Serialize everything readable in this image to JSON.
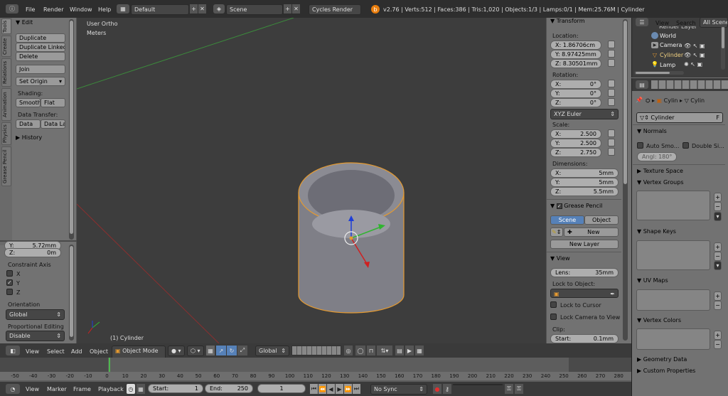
{
  "top_menu": {
    "file": "File",
    "render": "Render",
    "window": "Window",
    "help": "Help",
    "layout": "Default",
    "scene": "Scene",
    "engine": "Cycles Render",
    "stats": "v2.76 | Verts:512 | Faces:386 | Tris:1,020 | Objects:1/3 | Lamps:0/1 | Mem:25.76M | Cylinder"
  },
  "left_tabs": [
    "Tools",
    "Create",
    "Relations",
    "Animation",
    "Physics",
    "Grease Pencil"
  ],
  "tools": {
    "edit_header": "Edit",
    "duplicate": "Duplicate",
    "duplicate_linked": "Duplicate Linked",
    "delete": "Delete",
    "join": "Join",
    "set_origin": "Set Origin",
    "shading_label": "Shading:",
    "smooth": "Smooth",
    "flat": "Flat",
    "data_transfer_label": "Data Transfer:",
    "data": "Data",
    "data_layout": "Data La",
    "history": "History"
  },
  "operator": {
    "y_label": "Y:",
    "y_value": "5.72mm",
    "z_label": "Z:",
    "z_value": "0m",
    "constraint_axis": "Constraint Axis",
    "x": "X",
    "y": "Y",
    "z": "Z",
    "orientation_label": "Orientation",
    "orientation": "Global",
    "proportional_label": "Proportional Editing",
    "proportional": "Disable"
  },
  "viewport": {
    "view_name": "User Ortho",
    "units": "Meters",
    "object_label": "(1) Cylinder"
  },
  "view3d_header": {
    "view": "View",
    "select": "Select",
    "add": "Add",
    "object": "Object",
    "mode": "Object Mode",
    "orientation": "Global"
  },
  "properties_n": {
    "transform_header": "Transform",
    "location_label": "Location:",
    "loc_x_label": "X:",
    "loc_x": "1.86706cm",
    "loc_y_label": "Y:",
    "loc_y": "8.97425mm",
    "loc_z_label": "Z:",
    "loc_z": "8.30501mm",
    "rotation_label": "Rotation:",
    "rot_x_label": "X:",
    "rot_x": "0°",
    "rot_y_label": "Y:",
    "rot_y": "0°",
    "rot_z_label": "Z:",
    "rot_z": "0°",
    "rot_mode": "XYZ Euler",
    "scale_label": "Scale:",
    "sc_x_label": "X:",
    "sc_x": "2.500",
    "sc_y_label": "Y:",
    "sc_y": "2.500",
    "sc_z_label": "Z:",
    "sc_z": "2.750",
    "dimensions_label": "Dimensions:",
    "dim_x_label": "X:",
    "dim_x": "5mm",
    "dim_y_label": "Y:",
    "dim_y": "5mm",
    "dim_z_label": "Z:",
    "dim_z": "5.5mm",
    "grease_pencil_header": "Grease Pencil",
    "gp_scene": "Scene",
    "gp_object": "Object",
    "gp_new": "New",
    "gp_new_layer": "New Layer",
    "view_header": "View",
    "lens_label": "Lens:",
    "lens": "35mm",
    "lock_to_object": "Lock to Object:",
    "lock_to_cursor": "Lock to Cursor",
    "lock_camera": "Lock Camera to View",
    "clip_label": "Clip:",
    "clip_start_label": "Start:",
    "clip_start": "0.1mm"
  },
  "outliner": {
    "view": "View",
    "search": "Search",
    "filter": "All Scenes",
    "items": [
      "Render Layer",
      "World",
      "Camera",
      "Cylinder",
      "Lamp"
    ]
  },
  "properties": {
    "crumb1": "Cylin",
    "crumb2": "Cylin",
    "mesh_name": "Cylinder",
    "fake_user": "F",
    "normals_header": "Normals",
    "auto_smooth": "Auto Smo...",
    "double_sided": "Double Si...",
    "angle": "Angl: 180°",
    "texture_space": "Texture Space",
    "vertex_groups": "Vertex Groups",
    "shape_keys": "Shape Keys",
    "uv_maps": "UV Maps",
    "vertex_colors": "Vertex Colors",
    "geometry_data": "Geometry Data",
    "custom_properties": "Custom Properties"
  },
  "timeline": {
    "ticks": [
      "-50",
      "-40",
      "-30",
      "-20",
      "-10",
      "0",
      "10",
      "20",
      "30",
      "40",
      "50",
      "60",
      "70",
      "80",
      "90",
      "100",
      "110",
      "120",
      "130",
      "140",
      "150",
      "160",
      "170",
      "180",
      "190",
      "200",
      "210",
      "220",
      "230",
      "240",
      "250",
      "260",
      "270",
      "280"
    ],
    "current_frame": 1,
    "view": "View",
    "marker": "Marker",
    "frame": "Frame",
    "playback": "Playback",
    "start_label": "Start:",
    "start": "1",
    "end_label": "End:",
    "end": "250",
    "current": "1",
    "sync": "No Sync"
  },
  "colors": {
    "accent_blue": "#5681b8",
    "viewport_bg": "#3d3d3d",
    "panel_bg": "#727272",
    "header_bg": "#2e2e2e",
    "selection_orange": "#f0a030"
  }
}
